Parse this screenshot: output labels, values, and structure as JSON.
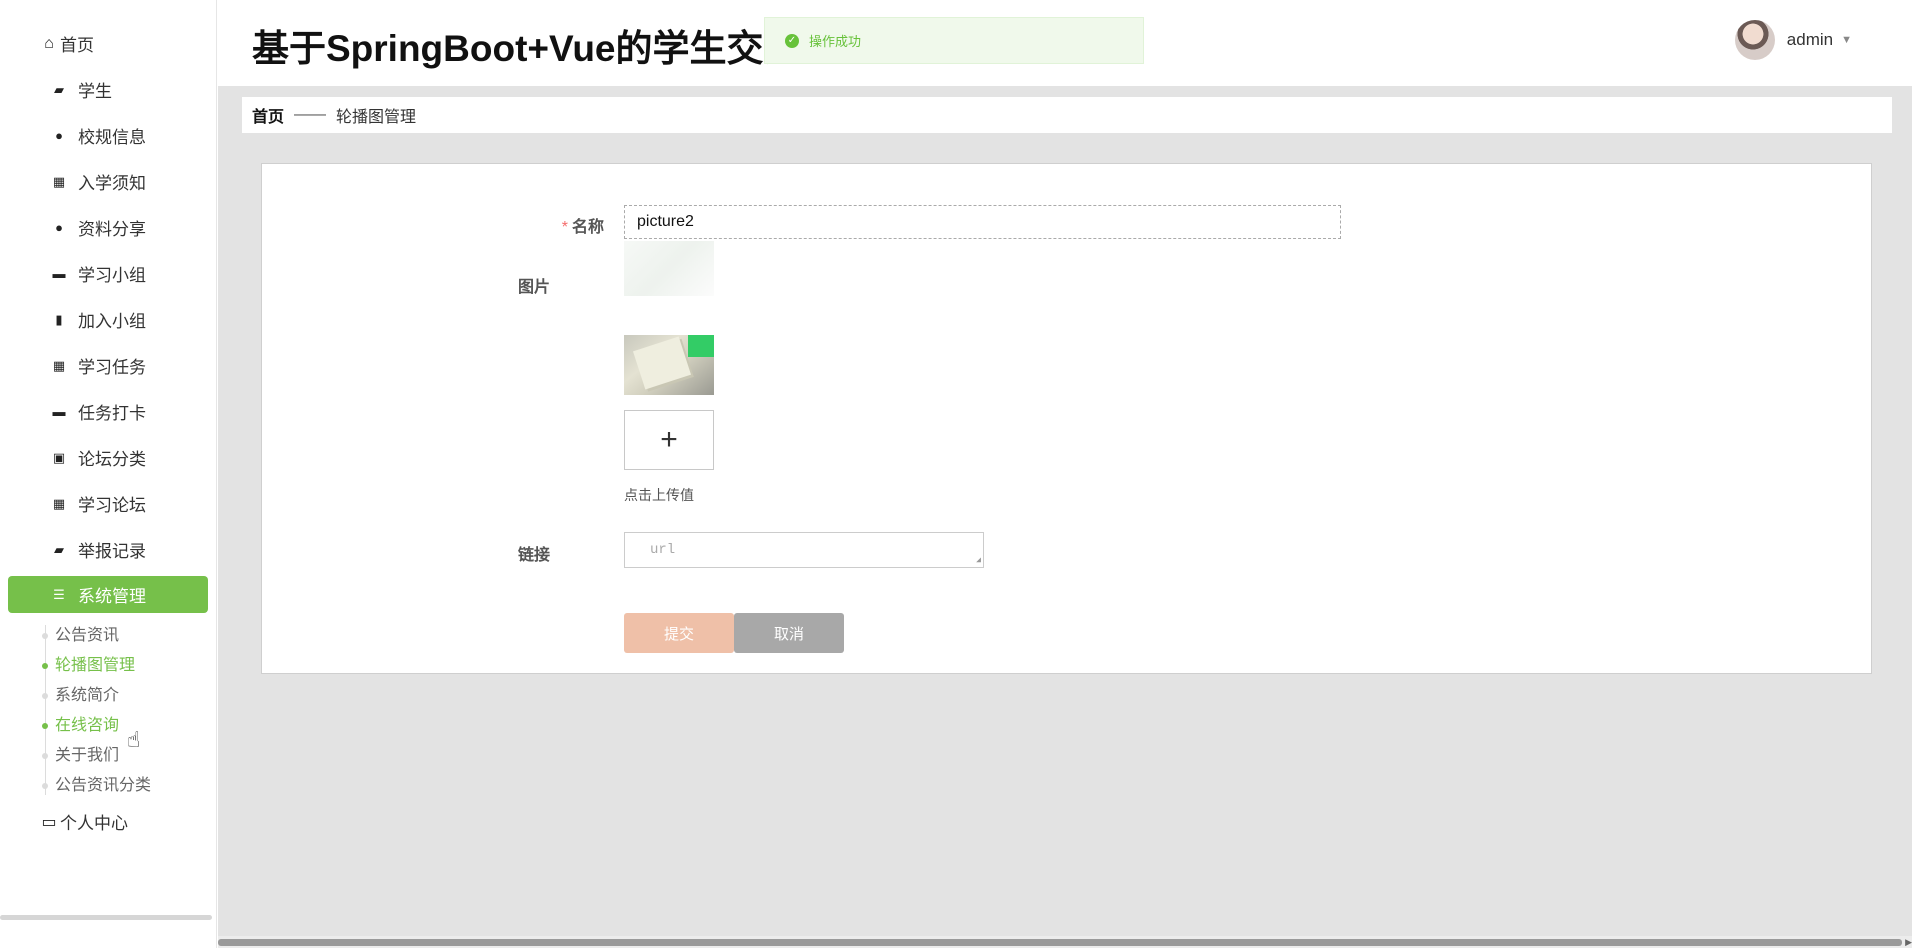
{
  "sidebar": {
    "top_home": {
      "icon": "home-icon",
      "label": "首页"
    },
    "items": [
      {
        "icon": "ticket-icon",
        "label": "学生"
      },
      {
        "icon": "user-icon",
        "label": "校规信息"
      },
      {
        "icon": "grid-icon",
        "label": "入学须知"
      },
      {
        "icon": "bulb-icon",
        "label": "资料分享"
      },
      {
        "icon": "briefcase-icon",
        "label": "学习小组"
      },
      {
        "icon": "clipboard-icon",
        "label": "加入小组"
      },
      {
        "icon": "grid-icon",
        "label": "学习任务"
      },
      {
        "icon": "monitor-icon",
        "label": "任务打卡"
      },
      {
        "icon": "checklist-icon",
        "label": "论坛分类"
      },
      {
        "icon": "grid-icon",
        "label": "学习论坛"
      },
      {
        "icon": "wallet-icon",
        "label": "举报记录"
      },
      {
        "icon": "menu-icon",
        "label": "系统管理"
      }
    ],
    "submenu": [
      "公告资讯",
      "轮播图管理",
      "系统简介",
      "在线咨询",
      "关于我们",
      "公告资讯分类"
    ],
    "bottom": {
      "icon": "card-icon",
      "label": "个人中心"
    }
  },
  "header": {
    "title": "基于SpringBoot+Vue的学生交流",
    "toast": "操作成功",
    "username": "admin"
  },
  "breadcrumb": {
    "home": "首页",
    "separator": "——",
    "current": "轮播图管理"
  },
  "form": {
    "name_label": "名称",
    "name_value": "picture2",
    "image_label": "图片",
    "upload_plus": "+",
    "upload_tip": "点击上传值",
    "link_label": "链接",
    "link_placeholder": "url",
    "submit_label": "提交",
    "cancel_label": "取消"
  },
  "colors": {
    "accent": "#76c04a",
    "submit": "#efc0a8",
    "cancel": "#a8a8a8",
    "toast_bg": "#f0f9eb"
  }
}
